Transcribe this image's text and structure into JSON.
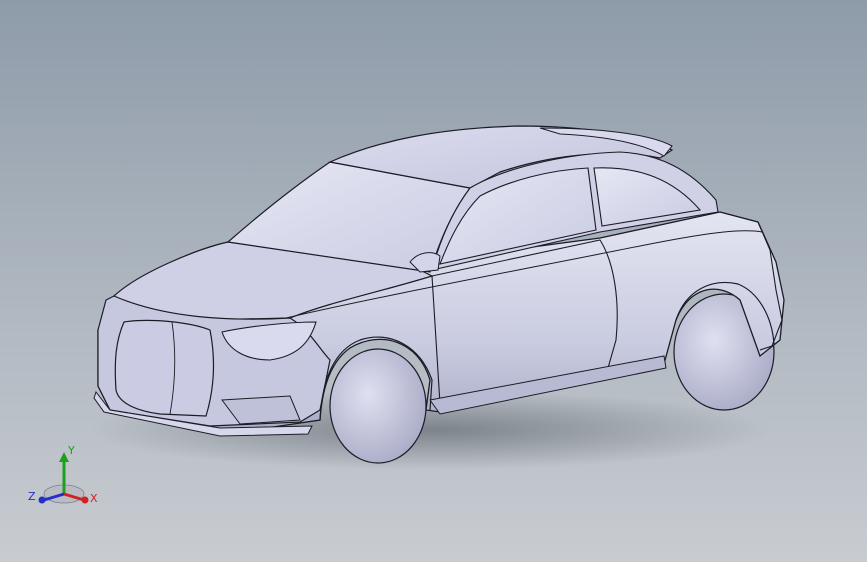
{
  "viewport": {
    "background_top": "#8e9ba9",
    "background_bottom": "#c8ccd1",
    "model_color": "#d3d4e8",
    "edge_color": "#1c1c26"
  },
  "triad": {
    "x_label": "X",
    "y_label": "Y",
    "z_label": "Z",
    "x_color": "#d42020",
    "y_color": "#1ea01e",
    "z_color": "#2030c8"
  }
}
